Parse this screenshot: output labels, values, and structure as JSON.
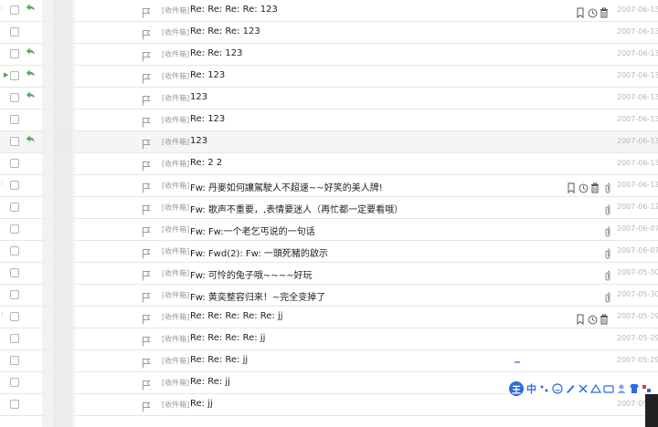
{
  "folder_tag": "[收件箱]",
  "rows": [
    {
      "subject": "Re: Re: Re: Re: 123",
      "date": "2007-06-13",
      "reply": true,
      "hover": true,
      "attach": false,
      "grip": true
    },
    {
      "subject": "Re: Re: Re: 123",
      "date": "2007-06-13",
      "reply": false,
      "hover": false,
      "attach": false,
      "grip": false
    },
    {
      "subject": "Re: Re: 123",
      "date": "2007-06-13",
      "reply": true,
      "hover": false,
      "attach": false,
      "grip": false
    },
    {
      "subject": "Re: 123",
      "date": "2007-06-13",
      "reply": true,
      "hover": false,
      "attach": false,
      "grip": false,
      "arrow": true
    },
    {
      "subject": "123",
      "date": "2007-06-13",
      "reply": true,
      "hover": false,
      "attach": false,
      "grip": false
    },
    {
      "subject": "Re: 123",
      "date": "2007-06-13",
      "reply": false,
      "hover": false,
      "attach": false,
      "grip": false
    },
    {
      "subject": "123",
      "date": "2007-06-13",
      "reply": true,
      "hover": false,
      "attach": false,
      "grip": false,
      "highlight": true
    },
    {
      "subject": "Re: 2 2",
      "date": "2007-06-13",
      "reply": false,
      "hover": false,
      "attach": false,
      "grip": false
    },
    {
      "subject": "Fw: 丹麥如何讓駕駛人不超速~~好笑的美人牌!",
      "date": "2007-06-12",
      "reply": false,
      "hover": true,
      "attach": true,
      "grip": true
    },
    {
      "subject": "Fw: 歌声不重要，,表情要迷人（再忙都一定要看哦）",
      "date": "2007-06-12",
      "reply": false,
      "hover": false,
      "attach": true,
      "grip": false
    },
    {
      "subject": "Fw: Fw:一个老乞丐说的一句话",
      "date": "2007-06-07",
      "reply": false,
      "hover": false,
      "attach": true,
      "grip": false
    },
    {
      "subject": "Fw: Fwd(2): Fw: 一頭死豬的啟示",
      "date": "2007-06-07",
      "reply": false,
      "hover": false,
      "attach": true,
      "grip": false
    },
    {
      "subject": "Fw: 可怜的兔子哦~~~~好玩",
      "date": "2007-05-30",
      "reply": false,
      "hover": false,
      "attach": true,
      "grip": false
    },
    {
      "subject": "Fw: 黄奕整容归来！~完全变掉了",
      "date": "2007-05-30",
      "reply": false,
      "hover": false,
      "attach": true,
      "grip": false
    },
    {
      "subject": "Re: Re: Re: Re: Re: jj",
      "date": "2007-05-29",
      "reply": false,
      "hover": true,
      "attach": false,
      "grip": true
    },
    {
      "subject": "Re: Re: Re: Re: jj",
      "date": "2007-05-29",
      "reply": false,
      "hover": false,
      "attach": false,
      "grip": false
    },
    {
      "subject": "Re: Re: Re: jj",
      "date": "2007-05-29",
      "reply": false,
      "hover": false,
      "attach": false,
      "grip": false
    },
    {
      "subject": "Re: Re: jj",
      "date": "",
      "reply": false,
      "hover": false,
      "attach": false,
      "grip": false
    },
    {
      "subject": "Re: jj",
      "date": "2007-05-2",
      "reply": false,
      "hover": false,
      "attach": false,
      "grip": false
    }
  ],
  "ime": {
    "logo": "王",
    "lang": "中"
  },
  "colors": {
    "reply_green": "#5aa55e",
    "date_gray": "#b8b8b8",
    "ime_blue": "#2d6bdf"
  }
}
